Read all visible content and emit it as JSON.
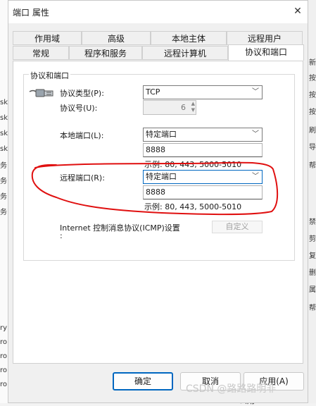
{
  "window": {
    "title": "端口 属性",
    "close_icon": "✕"
  },
  "tabs_top": [
    "作用域",
    "高级",
    "本地主体",
    "远程用户"
  ],
  "tabs_bottom": [
    "常规",
    "程序和服务",
    "远程计算机",
    "协议和端口"
  ],
  "active_tab": "协议和端口",
  "group": {
    "title": "协议和端口",
    "protocol_type_label": "协议类型(P):",
    "protocol_type_value": "TCP",
    "protocol_number_label": "协议号(U):",
    "protocol_number_value": "6",
    "local_port_label": "本地端口(L):",
    "local_port_mode": "特定端口",
    "local_port_value": "8888",
    "local_port_example": "示例: 80, 443, 5000-5010",
    "remote_port_label": "远程端口(R):",
    "remote_port_mode": "特定端口",
    "remote_port_value": "8888",
    "remote_port_example": "示例: 80, 443, 5000-5010",
    "icmp_label_line1": "Internet 控制消息协议(ICMP)设置",
    "icmp_label_line2": ":",
    "icmp_button": "自定义"
  },
  "buttons": {
    "ok": "确定",
    "cancel": "取消",
    "apply": "应用(A)"
  },
  "background": {
    "left_fragments": [
      "sk",
      "sk",
      "sk",
      "sk",
      "务",
      "务",
      "务",
      "务",
      "ry",
      "ro",
      "ro",
      "ro",
      "ro"
    ],
    "right_fragments": [
      "新",
      "按",
      "按",
      "按",
      "刷",
      "导",
      "帮",
      "禁",
      "剪",
      "复",
      "删",
      "属",
      "帮"
    ],
    "bottom_fragment": "公用"
  },
  "watermark": "CSDN @路路路明非",
  "annotation": {
    "color": "#e01010"
  }
}
